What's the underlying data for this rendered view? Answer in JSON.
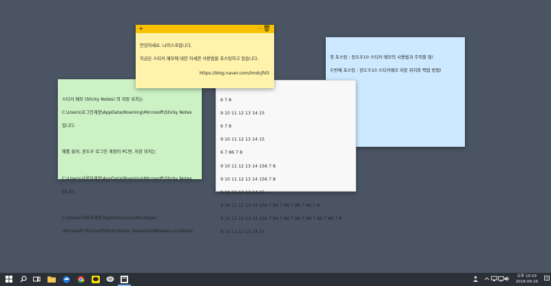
{
  "notes": {
    "yellow": {
      "lines": [
        "안녕하세요. 나이스포입니다.",
        "지금은 스티커 메모에 대한 자세한 사용법을 포스팅하고 있습니다."
      ],
      "link": "https://blog.naver.com/tmdcjfd3",
      "add_icon": "+",
      "more_icon": "···",
      "trash_icon": "🗑",
      "color": "#fff2ab",
      "bar_color": "#f9c100"
    },
    "blue": {
      "lines": [
        "첫 포스팅 : 윈도우10 스티커 메모의 사용법과 주의할 점!",
        "두번째 포스팅 : 윈도우10 스티커메모 저장 위치와 백업 방법!"
      ],
      "color": "#cde9ff"
    },
    "green": {
      "lines": [
        "스티커 메모 (Sticky Notes) 의 저장 위치는",
        "C:\\Users\\로그인계정\\AppData\\Roaming\\Microsoft\\Sticky Notes",
        "입니다.",
        "",
        "예를 들어, 윈도우 로그인 계정이 PC면, 저장 위치는",
        "",
        "C:\\Users\\사용자계정\\AppData\\Roaming\\Microsoft\\Sticky Notes",
        "입니다.",
        "",
        "C:\\Users\\사용자계정\\AppData\\Local\\Packages",
        "\\Microsoft.MicrosoftStickyNotes_8wekyb3d8bbwe\\LocalState"
      ],
      "color": "#cbf1c4"
    },
    "white": {
      "lines": [
        "6 7 8",
        "9 10 11 12 13 14 15",
        "6 7 8",
        "9 10 11 12 13 14 15",
        "6 7 86 7 8",
        "9 10 11 12 13 14 156 7 8",
        "9 10 11 12 13 14 156 7 8",
        "9 10 11 12 13 14 15",
        "9 10 11 12 13 14 156 7 86 7 86 7 86 7 86 7 8",
        "9 10 11 12 13 14 156 7 86 7 86 7 86 7 86 7 86 7 86 7 8",
        "9 10 11 12 13 14 15"
      ],
      "color": "#f8f8f8"
    }
  },
  "taskbar": {
    "start_icon": "windows-icon",
    "search_icon": "search-icon",
    "taskview_icon": "task-view-icon",
    "apps": [
      "file-explorer-icon",
      "edge-icon",
      "chrome-icon",
      "kakaotalk-icon",
      "app-icon",
      "sticky-notes-icon"
    ],
    "clock": {
      "ampm_time": "오후 10:19",
      "date": "2018-09-20"
    }
  }
}
